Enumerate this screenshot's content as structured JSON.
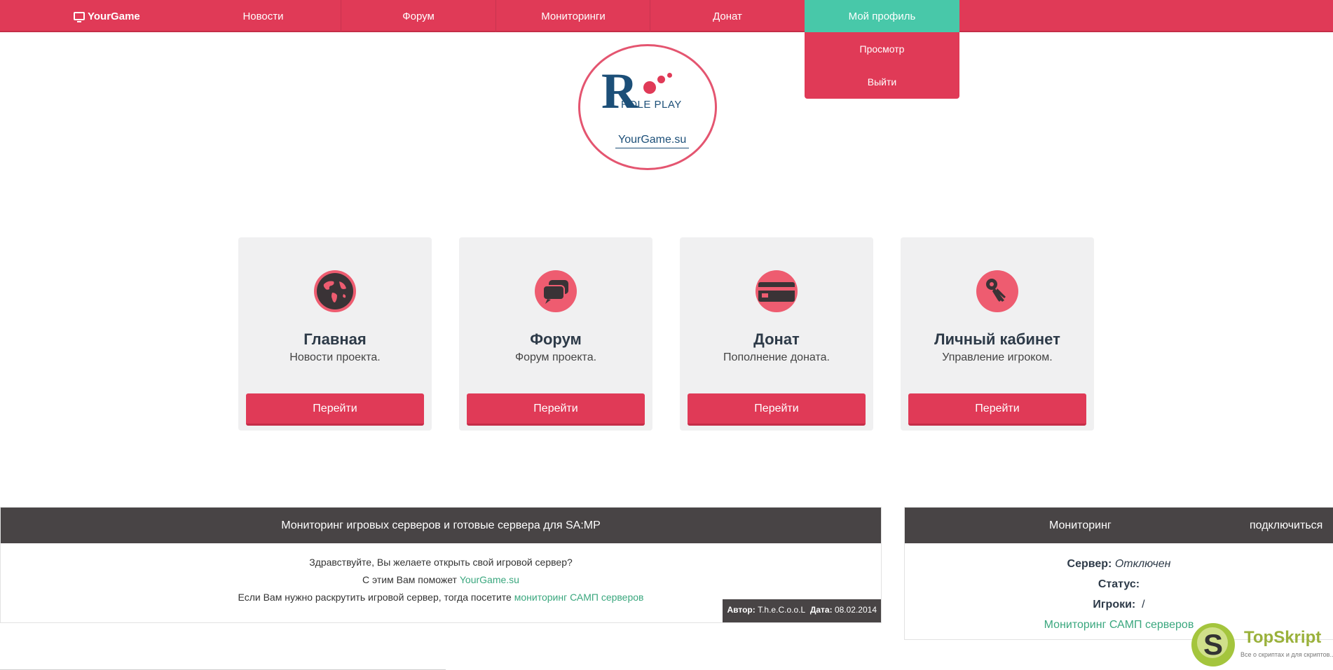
{
  "nav": {
    "brand": "YourGame",
    "items": [
      "Новости",
      "Форум",
      "Мониторинги",
      "Донат",
      "Мой профиль"
    ],
    "dropdown": [
      "Просмотр",
      "Выйти"
    ],
    "colors": {
      "primary": "#e03a57",
      "active": "#48c8a9"
    }
  },
  "logo": {
    "letter": "R",
    "tagline": "ROLE PLAY",
    "site": "YourGame.su"
  },
  "cards": [
    {
      "title": "Главная",
      "sub": "Новости проекта.",
      "button": "Перейти",
      "icon": "globe-icon"
    },
    {
      "title": "Форум",
      "sub": "Форум проекта.",
      "button": "Перейти",
      "icon": "chat-bubbles-icon"
    },
    {
      "title": "Донат",
      "sub": "Пополнение доната.",
      "button": "Перейти",
      "icon": "credit-card-icon"
    },
    {
      "title": "Личный кабинет",
      "sub": "Управление игроком.",
      "button": "Перейти",
      "icon": "keys-icon"
    }
  ],
  "news": {
    "header": "Мониторинг игровых серверов и готовые сервера для SA:MP",
    "line1": "Здравствуйте, Вы желаете открыть свой игровой сервер?",
    "line2_prefix": "С этим Вам поможет ",
    "line2_link": "YourGame.su",
    "line3_prefix": "Если Вам нужно раскрутить игровой сервер, тогда посетите ",
    "line3_link": "мониторинг САМП серверов",
    "author_label": "Автор:",
    "author": "T.h.e.C.o.o.L",
    "date_label": "Дата:",
    "date": "08.02.2014"
  },
  "monitor": {
    "title": "Мониторинг",
    "connect": "подключиться",
    "server_label": "Сервер:",
    "server_value": "Отключен",
    "status_label": "Статус:",
    "players_label": "Игроки:",
    "players_value": "/",
    "link": "Мониторинг САМП серверов"
  },
  "watermark": {
    "letter": "S",
    "name": "TopSkript",
    "slogan": "Все о скриптах и для скриптов..."
  }
}
